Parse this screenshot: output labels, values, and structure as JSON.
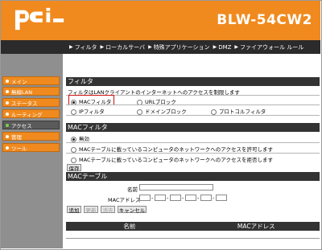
{
  "brand": {
    "logo_text": "pci",
    "model": "BLW-54CW2"
  },
  "top_tabs": [
    "フィルタ",
    "ローカルサーバ",
    "特殊アプリケーション",
    "DMZ",
    "ファイアウォール ルール"
  ],
  "sidebar": {
    "items": [
      {
        "label": "メイン",
        "active": false
      },
      {
        "label": "無線LAN",
        "active": false
      },
      {
        "label": "ステータス",
        "active": false
      },
      {
        "label": "ルーティング",
        "active": false
      },
      {
        "label": "アクセス",
        "active": true
      },
      {
        "label": "管理",
        "active": false
      },
      {
        "label": "ツール",
        "active": false
      }
    ]
  },
  "filter": {
    "title": "フィルタ",
    "description": "フィルタはLANクライアントのインターネットへのアクセスを制限します",
    "options": [
      {
        "label": "MACフィルタ",
        "selected": true
      },
      {
        "label": "URLブロック",
        "selected": false
      },
      {
        "label": "IPフィルタ",
        "selected": false
      },
      {
        "label": "ドメインブロック",
        "selected": false
      },
      {
        "label": "プロトコルフィルタ",
        "selected": false
      }
    ]
  },
  "mac_filter": {
    "title": "MACフィルタ",
    "options": [
      {
        "label": "無効",
        "selected": true
      },
      {
        "label": "MACテーブルに載っているコンピュータのネットワークへのアクセスを許可します",
        "selected": false
      },
      {
        "label": "MACテーブルに載っているコンピュータのネットワークへのアクセスを拒否します",
        "selected": false
      }
    ],
    "save_label": "保存"
  },
  "mac_table": {
    "title": "MACテーブル",
    "name_label": "名前",
    "mac_label": "MACアドレス",
    "buttons": {
      "add": "追加",
      "update": "更新",
      "delete": "消去",
      "cancel": "キャンセル"
    },
    "columns": [
      "名前",
      "MACアドレス"
    ]
  }
}
